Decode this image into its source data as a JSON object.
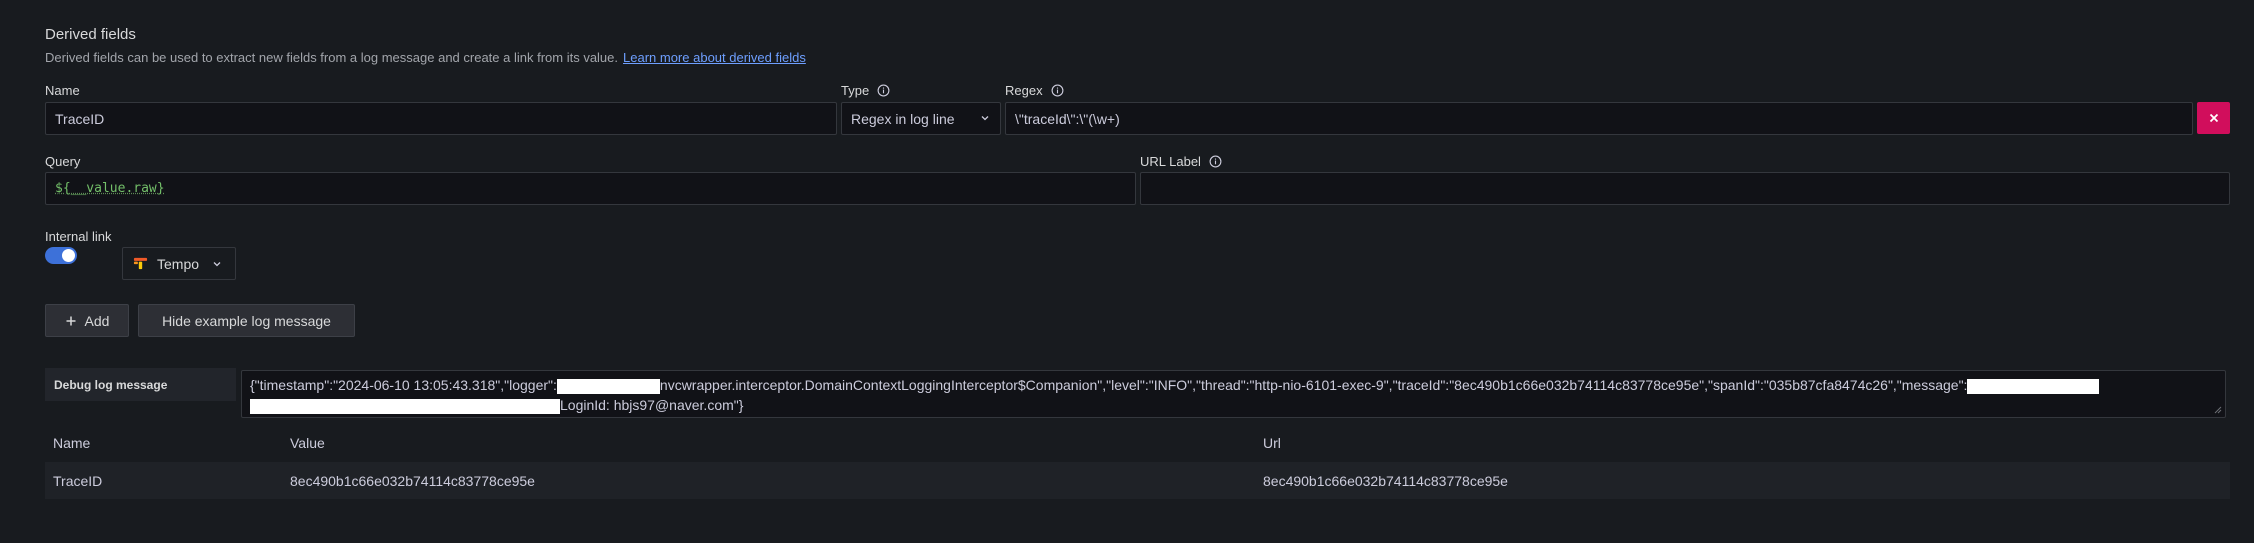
{
  "header": {
    "title": "Derived fields",
    "description": "Derived fields can be used to extract new fields from a log message and create a link from its value.",
    "learn_more_link": "Learn more about derived fields"
  },
  "field": {
    "name_label": "Name",
    "name_value": "TraceID",
    "type_label": "Type",
    "type_value": "Regex in log line",
    "regex_label": "Regex",
    "regex_value": "\\\"traceId\\\":\\\"(\\w+)",
    "query_label": "Query",
    "query_value": "${__value.raw}",
    "url_label_label": "URL Label",
    "url_label_value": ""
  },
  "internal_link": {
    "label": "Internal link",
    "enabled": true,
    "datasource": "Tempo"
  },
  "buttons": {
    "add": "Add",
    "hide_example": "Hide example log message"
  },
  "debug": {
    "label": "Debug log message",
    "part1": "{\"timestamp\":\"2024-06-10 13:05:43.318\",\"logger\":",
    "part2": "nvcwrapper.interceptor.DomainContextLoggingInterceptor$Companion\",\"level\":\"INFO\",\"thread\":\"http-nio-6101-exec-9\",\"traceId\":\"8ec490b1c66e032b74114c83778ce95e\",\"spanId\":\"035b87cfa8474c26\",\"message\":",
    "part3": "LoginId: hbjs97@naver.com\"}"
  },
  "table": {
    "headers": {
      "name": "Name",
      "value": "Value",
      "url": "Url"
    },
    "rows": [
      {
        "name": "TraceID",
        "value": "8ec490b1c66e032b74114c83778ce95e",
        "url": "8ec490b1c66e032b74114c83778ce95e"
      }
    ]
  },
  "colors": {
    "background": "#181b1f",
    "remove_button": "#d10e5c",
    "toggle_on": "#3d71d9",
    "link": "#6e9fff",
    "query_text": "#73bf69"
  },
  "icons": {
    "info": "info-circle-icon",
    "chevron": "chevron-down-icon",
    "remove": "times-icon",
    "add": "plus-icon",
    "tempo": "tempo-logo-icon"
  }
}
